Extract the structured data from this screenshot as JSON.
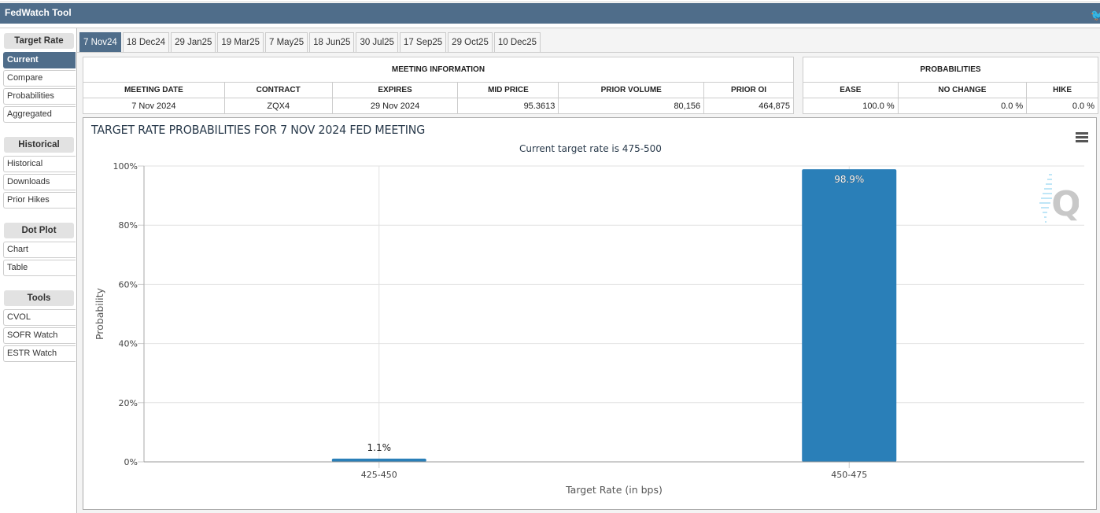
{
  "app": {
    "title": "FedWatch Tool",
    "twitter_icon": "twitter-bird-icon"
  },
  "sidebar": {
    "groups": [
      {
        "header": "Target Rate",
        "items": [
          "Current",
          "Compare",
          "Probabilities",
          "Aggregated"
        ],
        "active": "Current"
      },
      {
        "header": "Historical",
        "items": [
          "Historical",
          "Downloads",
          "Prior Hikes"
        ]
      },
      {
        "header": "Dot Plot",
        "items": [
          "Chart",
          "Table"
        ]
      },
      {
        "header": "Tools",
        "items": [
          "CVOL",
          "SOFR Watch",
          "ESTR Watch"
        ]
      }
    ]
  },
  "tabs": [
    "7 Nov24",
    "18 Dec24",
    "29 Jan25",
    "19 Mar25",
    "7 May25",
    "18 Jun25",
    "30 Jul25",
    "17 Sep25",
    "29 Oct25",
    "10 Dec25"
  ],
  "active_tab": "7 Nov24",
  "meeting_info": {
    "title": "MEETING INFORMATION",
    "headers": [
      "MEETING DATE",
      "CONTRACT",
      "EXPIRES",
      "MID PRICE",
      "PRIOR VOLUME",
      "PRIOR OI"
    ],
    "row": [
      "7 Nov 2024",
      "ZQX4",
      "29 Nov 2024",
      "95.3613",
      "80,156",
      "464,875"
    ]
  },
  "probabilities": {
    "title": "PROBABILITIES",
    "headers": [
      "EASE",
      "NO CHANGE",
      "HIKE"
    ],
    "row": [
      "100.0 %",
      "0.0 %",
      "0.0 %"
    ]
  },
  "chart": {
    "menu_icon": "hamburger-menu-icon",
    "logo": "cme-q-logo"
  },
  "colors": {
    "bar": "#2a7fb8",
    "header": "#4f6d8a"
  },
  "chart_data": {
    "type": "bar",
    "title": "TARGET RATE PROBABILITIES FOR 7 NOV 2024 FED MEETING",
    "subtitle": "Current target rate is 475-500",
    "categories": [
      "425-450",
      "450-475"
    ],
    "values": [
      1.1,
      98.9
    ],
    "data_labels": [
      "1.1%",
      "98.9%"
    ],
    "xlabel": "Target Rate (in bps)",
    "ylabel": "Probability",
    "ylim": [
      0,
      100
    ],
    "yticks": [
      "0%",
      "20%",
      "40%",
      "60%",
      "80%",
      "100%"
    ],
    "grid": true,
    "legend": "none"
  }
}
